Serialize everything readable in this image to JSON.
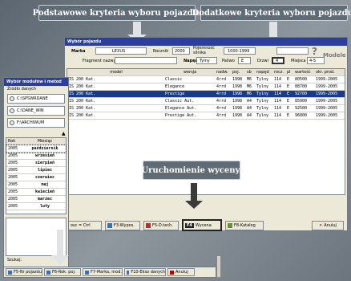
{
  "callouts": {
    "basic": "Podstawowe kryteria wyboru pojazdu.",
    "extra": "Dodatkowe kryteria wyboru pojazdu.",
    "valuation": "Uruchomienie wyceny."
  },
  "left_window": {
    "title": "Wybór modułów i metod",
    "source_label": "Źródło danych",
    "sources": [
      "C:\\SPSWRDANE",
      "C:\\DANE_WIN",
      "F:\\ARCHIWUM"
    ],
    "months_header": {
      "year": "Rok",
      "month": "Miesiąc"
    },
    "months": [
      {
        "year": "2005",
        "month": "październik"
      },
      {
        "year": "2005",
        "month": "wrzesień"
      },
      {
        "year": "2005",
        "month": "sierpień"
      },
      {
        "year": "2005",
        "month": "lipiec"
      },
      {
        "year": "2005",
        "month": "czerwiec"
      },
      {
        "year": "2005",
        "month": "maj"
      },
      {
        "year": "2005",
        "month": "kwiecień"
      },
      {
        "year": "2005",
        "month": "marzec"
      },
      {
        "year": "2005",
        "month": "luty"
      }
    ],
    "status": "Szukaj:",
    "buttons": [
      "F5-Nr pojazdu",
      "F6-Rok. poj.",
      "F7-Marka, mod.",
      "F10-Ekso danych",
      "Anuluj"
    ]
  },
  "main_window": {
    "title": "Wybór pojazdu",
    "filters": {
      "marka_label": "Marka",
      "marka_value": "LEXUS",
      "rocznik_label": "Rocznik",
      "rocznik_value": "2000",
      "pojemnosc_label": "Pojemność silnika",
      "pojemnosc_value": "1000-1999",
      "fragment_label": "Fragment nazwy",
      "fragment_value": "",
      "naped_label": "Napęd",
      "naped_value": "Tylny",
      "paliwo_label": "Paliwo",
      "paliwo_value": "E",
      "drzwi_label": "Drzwi",
      "drzwi_value": "4",
      "miejsca_label": "Miejsca",
      "miejsca_value": "4-5",
      "help": "?",
      "modele": "Modele"
    },
    "table": {
      "columns": [
        "model",
        "wersja",
        "nadw.",
        "poj.",
        "sb",
        "napęd",
        "rocz.",
        "pl",
        "wartość",
        "okr. prod."
      ],
      "rows": [
        [
          "IS 200 Kat.",
          "Classic",
          "4rrd",
          "1998",
          "M6",
          "Tylny",
          "114",
          "E",
          "80500",
          "1999-2005"
        ],
        [
          "IS 200 Kat.",
          "Elegance",
          "4rrd",
          "1998",
          "M6",
          "Tylny",
          "114",
          "E",
          "88700",
          "1999-2005"
        ],
        [
          "IS 200 Kat.",
          "Prestige",
          "4rrd",
          "1998",
          "M6",
          "Tylny",
          "114",
          "E",
          "92700",
          "1999-2005"
        ],
        [
          "IS 200 Kat.",
          "Classic Aut.",
          "4rrd",
          "1998",
          "A4",
          "Tylny",
          "114",
          "E",
          "85000",
          "1999-2005"
        ],
        [
          "IS 200 Kat.",
          "Elegance Aut.",
          "4rrd",
          "1998",
          "A4",
          "Tylny",
          "114",
          "E",
          "92500",
          "1999-2005"
        ],
        [
          "IS 200 Kat.",
          "Prestige Aut.",
          "4rrd",
          "1998",
          "A4",
          "Tylny",
          "114",
          "E",
          "96800",
          "1999-2005"
        ]
      ]
    },
    "footer": {
      "b1": "osc = Ctrl",
      "b2": "F3-Wypos.",
      "b3": "F5-D.tech.",
      "b4": "F4",
      "b4b": "Wycena",
      "b5": "F8-Katalog",
      "b6": "Anuluj"
    }
  }
}
